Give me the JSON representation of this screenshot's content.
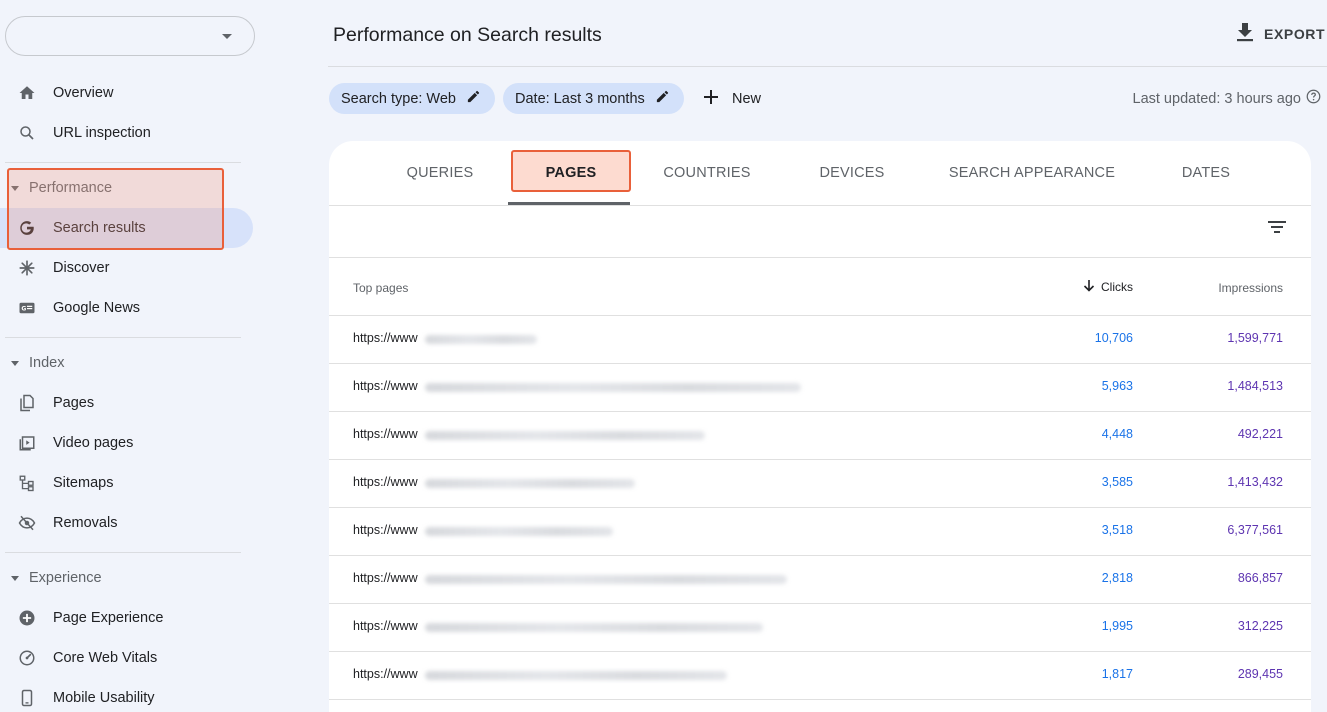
{
  "sidebar": {
    "property_value": "",
    "top_items": [
      {
        "label": "Overview",
        "icon": "home-icon"
      },
      {
        "label": "URL inspection",
        "icon": "search-icon"
      }
    ],
    "sections": [
      {
        "title": "Performance",
        "items": [
          {
            "label": "Search results",
            "icon": "google-g-icon",
            "active": true
          },
          {
            "label": "Discover",
            "icon": "asterisk-icon"
          },
          {
            "label": "Google News",
            "icon": "news-icon"
          }
        ]
      },
      {
        "title": "Index",
        "items": [
          {
            "label": "Pages",
            "icon": "pages-icon"
          },
          {
            "label": "Video pages",
            "icon": "video-icon"
          },
          {
            "label": "Sitemaps",
            "icon": "sitemap-icon"
          },
          {
            "label": "Removals",
            "icon": "eye-off-icon"
          }
        ]
      },
      {
        "title": "Experience",
        "items": [
          {
            "label": "Page Experience",
            "icon": "plus-circle-icon"
          },
          {
            "label": "Core Web Vitals",
            "icon": "gauge-icon"
          },
          {
            "label": "Mobile Usability",
            "icon": "phone-icon"
          }
        ]
      }
    ]
  },
  "header": {
    "title": "Performance on Search results",
    "export_label": "EXPORT"
  },
  "filters": {
    "chips": [
      {
        "label": "Search type: Web"
      },
      {
        "label": "Date: Last 3 months"
      }
    ],
    "new_label": "New",
    "last_updated": "Last updated: 3 hours ago"
  },
  "tabs": [
    {
      "label": "QUERIES",
      "active": false
    },
    {
      "label": "PAGES",
      "active": true
    },
    {
      "label": "COUNTRIES",
      "active": false
    },
    {
      "label": "DEVICES",
      "active": false
    },
    {
      "label": "SEARCH APPEARANCE",
      "active": false
    },
    {
      "label": "DATES",
      "active": false
    }
  ],
  "table": {
    "columns": {
      "page": "Top pages",
      "clicks": "Clicks",
      "impressions": "Impressions"
    },
    "sort": {
      "column": "Clicks",
      "direction": "descending"
    },
    "rows": [
      {
        "url": "https://www",
        "clicks": "10,706",
        "impressions": "1,599,771"
      },
      {
        "url": "https://www",
        "clicks": "5,963",
        "impressions": "1,484,513"
      },
      {
        "url": "https://www",
        "clicks": "4,448",
        "impressions": "492,221"
      },
      {
        "url": "https://www",
        "clicks": "3,585",
        "impressions": "1,413,432"
      },
      {
        "url": "https://www",
        "clicks": "3,518",
        "impressions": "6,377,561"
      },
      {
        "url": "https://www",
        "clicks": "2,818",
        "impressions": "866,857"
      },
      {
        "url": "https://www",
        "clicks": "1,995",
        "impressions": "312,225"
      },
      {
        "url": "https://www",
        "clicks": "1,817",
        "impressions": "289,455"
      }
    ]
  },
  "colors": {
    "accent_blue": "#1a73e8",
    "impressions_purple": "#5e35b1",
    "highlight_orange": "#e9603a",
    "chip_bg": "#d3e1fa",
    "page_bg": "#f1f4fb"
  }
}
